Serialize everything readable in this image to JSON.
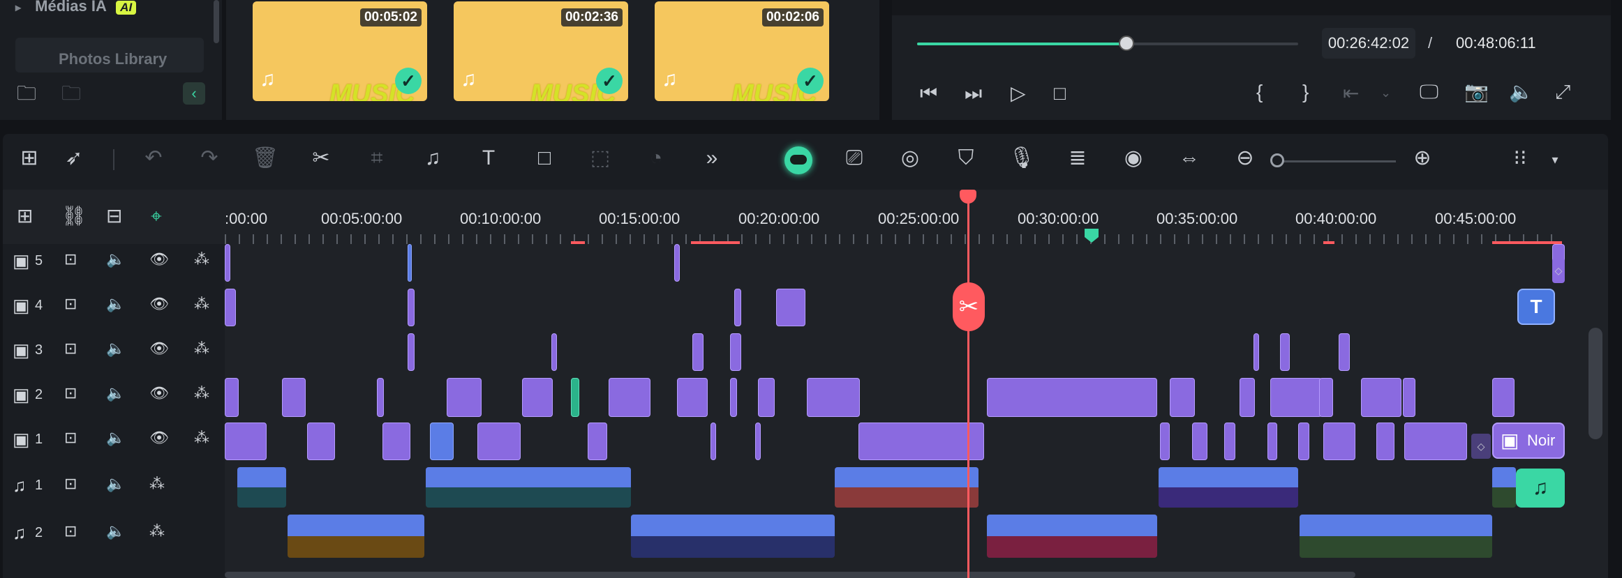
{
  "library": {
    "items": [
      {
        "label": "Médias IA",
        "badge": "AI"
      },
      {
        "label": "Photos Library"
      }
    ]
  },
  "media": {
    "thumbs": [
      {
        "duration": "00:05:02",
        "word": "MUSIC"
      },
      {
        "duration": "00:02:36",
        "word": "MUSIC"
      },
      {
        "duration": "00:02:06",
        "word": "MUSIC"
      }
    ]
  },
  "preview": {
    "current_time": "00:26:42:02",
    "separator": "/",
    "total_time": "00:48:06:11",
    "progress_percent": 55
  },
  "ruler": {
    "labels": [
      ":00:00",
      "00:05:00:00",
      "00:10:00:00",
      "00:15:00:00",
      "00:20:00:00",
      "00:25:00:00",
      "00:30:00:00",
      "00:35:00:00",
      "00:40:00:00",
      "00:45:00:00"
    ]
  },
  "tracks": {
    "video": [
      {
        "label": "5"
      },
      {
        "label": "4"
      },
      {
        "label": "3"
      },
      {
        "label": "2"
      },
      {
        "label": "1"
      }
    ],
    "audio": [
      {
        "label": "1"
      },
      {
        "label": "2"
      }
    ]
  },
  "chips": {
    "image_clip_label": "Noir",
    "title_glyph": "T"
  },
  "colors": {
    "accent": "#3ad7a4",
    "playhead": "#ff5a5f",
    "clip_purple": "#8a6ae0",
    "clip_blue": "#5b7de6",
    "thumb_yellow": "#f5c75e"
  },
  "icons": {
    "toolbar": [
      "layout-grid-icon",
      "select-pointer-icon",
      "undo-icon",
      "redo-icon",
      "delete-icon",
      "scissors-icon",
      "crop-icon",
      "audio-icon",
      "text-icon",
      "shape-icon",
      "mask-icon",
      "speed-icon",
      "more-icon",
      "ai-assistant-icon",
      "ai-camera-icon",
      "stabilize-icon",
      "marker-icon",
      "microphone-icon",
      "music-list-icon",
      "eye-mask-icon",
      "fit-width-icon",
      "zoom-out-icon",
      "zoom-in-icon",
      "layout-menu-icon"
    ]
  }
}
